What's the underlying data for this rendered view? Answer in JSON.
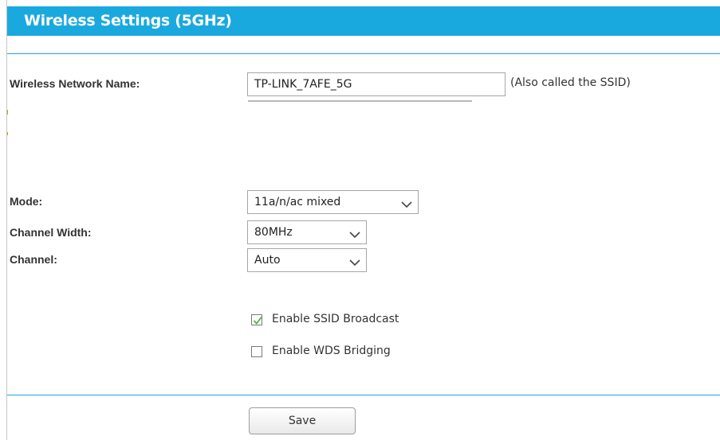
{
  "header": {
    "title": "Wireless Settings (5GHz)"
  },
  "ssid": {
    "label": "Wireless Network Name:",
    "value": "TP-LINK_7AFE_5G",
    "hint": "(Also called the SSID)"
  },
  "mode": {
    "label": "Mode:",
    "selected": "11a/n/ac mixed",
    "icon": "chevron-down-icon"
  },
  "channel_width": {
    "label": "Channel Width:",
    "selected": "80MHz",
    "icon": "chevron-down-icon"
  },
  "channel": {
    "label": "Channel:",
    "selected": "Auto",
    "icon": "chevron-down-icon"
  },
  "options": {
    "ssid_broadcast": {
      "label": "Enable SSID Broadcast",
      "checked": true
    },
    "wds_bridging": {
      "label": "Enable WDS Bridging",
      "checked": false
    }
  },
  "actions": {
    "save_label": "Save"
  },
  "colors": {
    "accent": "#1aa9de",
    "checkmark": "#4caf50"
  }
}
